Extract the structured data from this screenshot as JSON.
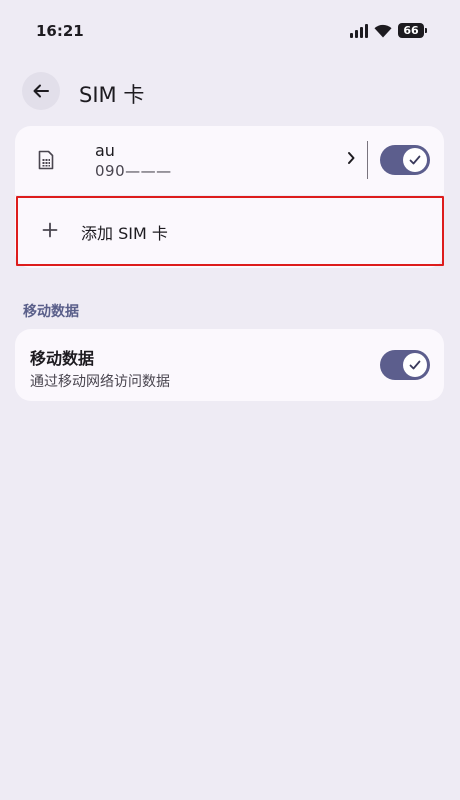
{
  "status_bar": {
    "time": "16:21",
    "battery": "66",
    "icons": [
      "signal-icon",
      "wifi-icon",
      "battery-icon"
    ]
  },
  "header": {
    "back_icon": "arrow-back-icon",
    "title": "SIM 卡"
  },
  "sim": {
    "icon": "sim-card-icon",
    "name": "au",
    "number": "090———",
    "enabled": true
  },
  "add_sim": {
    "icon": "plus-icon",
    "label": "添加 SIM 卡"
  },
  "mobile_data": {
    "section_title": "移动数据",
    "title": "移动数据",
    "subtitle": "通过移动网络访问数据",
    "enabled": true
  },
  "colors": {
    "background": "#eeebf4",
    "card": "#fbf8fd",
    "accent": "#5c5e8d",
    "highlight": "#dd1c1c"
  }
}
